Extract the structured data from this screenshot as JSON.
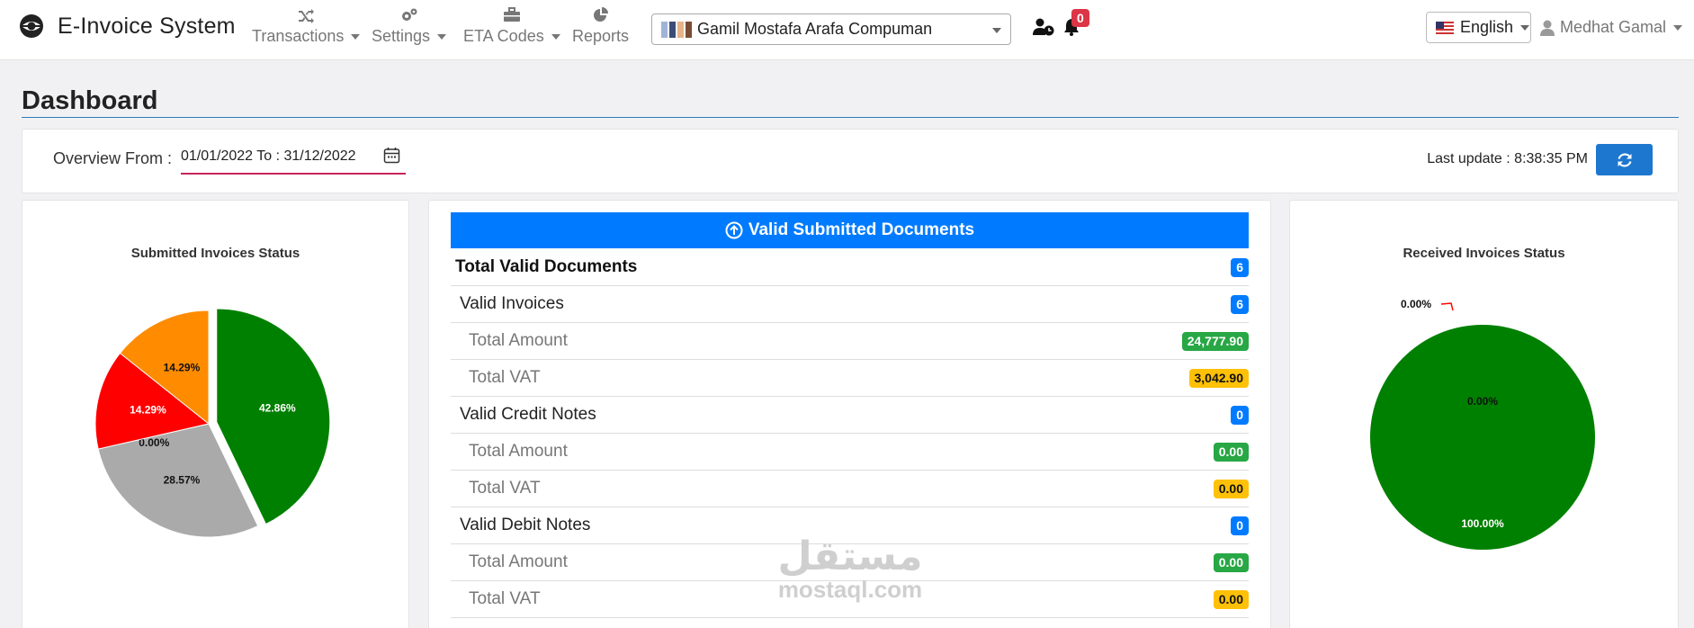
{
  "app": {
    "title": "E-Invoice System"
  },
  "nav": {
    "transactions": "Transactions",
    "settings": "Settings",
    "eta_codes": "ETA Codes",
    "reports": "Reports"
  },
  "company": {
    "selected": "Gamil Mostafa Arafa Compuman"
  },
  "notifications": {
    "count": "0"
  },
  "language": {
    "selected": "English"
  },
  "user": {
    "name": "Medhat Gamal"
  },
  "page": {
    "title": "Dashboard"
  },
  "filter": {
    "label": "Overview From :",
    "range": "01/01/2022 To : 31/12/2022",
    "last_update": "Last update : 8:38:35 PM"
  },
  "colors": {
    "green": "#008000",
    "gray": "#aaaaaa",
    "red": "#ff0000",
    "orange": "#ff8c00",
    "accent": "#007bff"
  },
  "chart_data": [
    {
      "type": "pie",
      "title": "Submitted Invoices Status",
      "slices": [
        {
          "label": "42.86%",
          "value": 42.86,
          "color": "#008000",
          "exploded": true
        },
        {
          "label": "28.57%",
          "value": 28.57,
          "color": "#aaaaaa"
        },
        {
          "label": "0.00%",
          "value": 0.0,
          "color": "#000000"
        },
        {
          "label": "14.29%",
          "value": 14.29,
          "color": "#ff0000"
        },
        {
          "label": "14.29%",
          "value": 14.29,
          "color": "#ff8c00"
        }
      ]
    },
    {
      "type": "pie",
      "title": "Received Invoices Status",
      "slices": [
        {
          "label": "100.00%",
          "value": 100.0,
          "color": "#008000"
        },
        {
          "label": "0.00%",
          "value": 0.0,
          "color": "#ff0000"
        },
        {
          "label": "0.00%",
          "value": 0.0,
          "color": "#000000"
        }
      ]
    }
  ],
  "valid_docs": {
    "header": "Valid Submitted Documents",
    "rows": [
      {
        "label": "Total Valid Documents",
        "value": "6",
        "level": 0,
        "badge": "blue"
      },
      {
        "label": "Valid Invoices",
        "value": "6",
        "level": 1,
        "badge": "blue"
      },
      {
        "label": "Total Amount",
        "value": "24,777.90",
        "level": 2,
        "badge": "green"
      },
      {
        "label": "Total VAT",
        "value": "3,042.90",
        "level": 2,
        "badge": "yellow"
      },
      {
        "label": "Valid Credit Notes",
        "value": "0",
        "level": 1,
        "badge": "blue"
      },
      {
        "label": "Total Amount",
        "value": "0.00",
        "level": 2,
        "badge": "green"
      },
      {
        "label": "Total VAT",
        "value": "0.00",
        "level": 2,
        "badge": "yellow"
      },
      {
        "label": "Valid Debit Notes",
        "value": "0",
        "level": 1,
        "badge": "blue"
      },
      {
        "label": "Total Amount",
        "value": "0.00",
        "level": 2,
        "badge": "green"
      },
      {
        "label": "Total VAT",
        "value": "0.00",
        "level": 2,
        "badge": "yellow"
      }
    ]
  },
  "watermark": {
    "arabic": "مستقل",
    "latin": "mostaql.com"
  }
}
